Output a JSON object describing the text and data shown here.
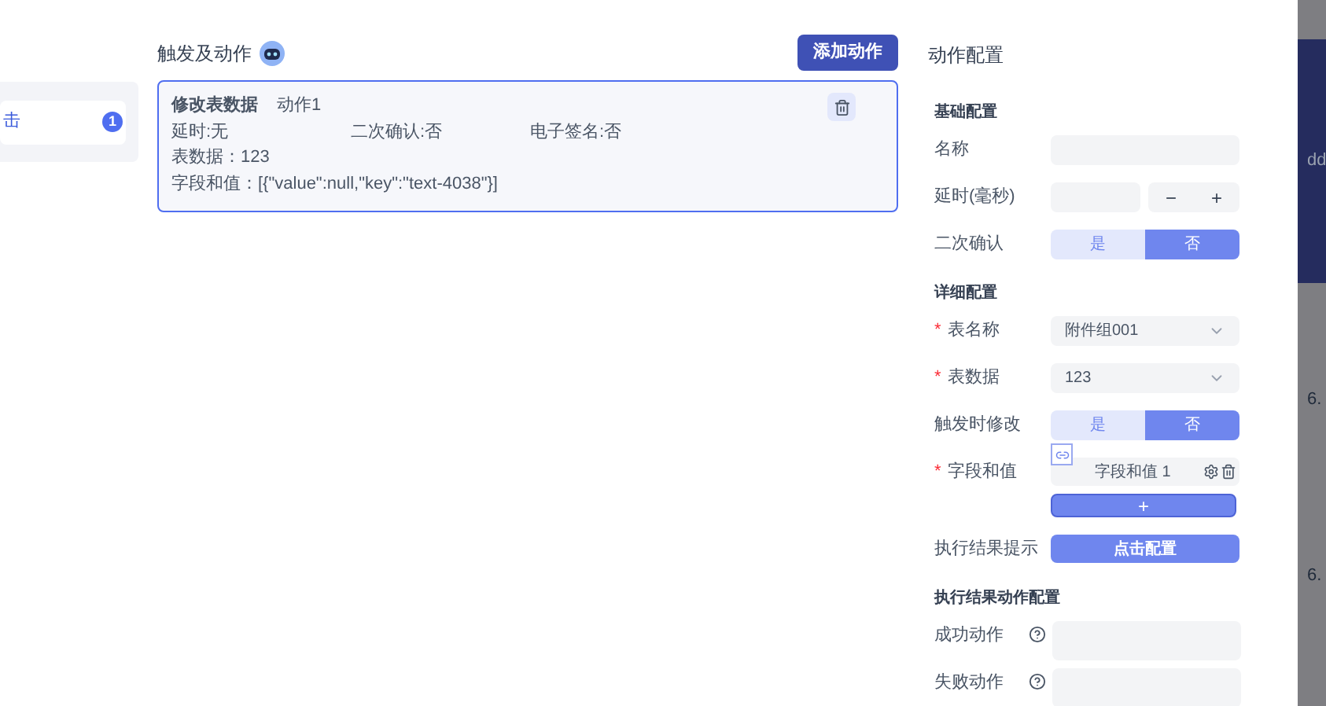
{
  "left_panel": {
    "item": {
      "label": "击",
      "badge": "1",
      "selected": true
    }
  },
  "triggers": {
    "title": "触发及动作",
    "add_button": "添加动作",
    "actions": [
      {
        "type": "修改表数据",
        "name": "动作1",
        "delay": "延时:无",
        "confirm": "二次确认:否",
        "signature": "电子签名:否",
        "table_data": "表数据：123",
        "fields": "字段和值：[{\"value\":null,\"key\":\"text-4038\"}]",
        "selected": true
      }
    ]
  },
  "config": {
    "title": "动作配置",
    "sections": [
      {
        "title": "基础配置",
        "rows": [
          {
            "kind": "input",
            "label": "名称"
          },
          {
            "kind": "stepper",
            "label": "延时(毫秒)",
            "minus": "−",
            "plus": "+"
          },
          {
            "kind": "toggle",
            "label": "二次确认",
            "options": [
              {
                "label": "是",
                "selected": false
              },
              {
                "label": "否",
                "selected": true
              }
            ]
          }
        ]
      },
      {
        "title": "详细配置",
        "rows": [
          {
            "kind": "select",
            "label": "表名称",
            "required": "*",
            "value": "附件组001"
          },
          {
            "kind": "select",
            "label": "表数据",
            "required": "*",
            "value": "123"
          },
          {
            "kind": "toggle",
            "label": "触发时修改",
            "link": true,
            "options": [
              {
                "label": "是",
                "selected": false
              },
              {
                "label": "否",
                "selected": true
              }
            ]
          },
          {
            "kind": "fieldlist",
            "label": "字段和值",
            "required": "*",
            "items": [
              "字段和值 1"
            ],
            "add": "+"
          },
          {
            "kind": "button",
            "label": "执行结果提示",
            "button": "点击配置"
          }
        ]
      },
      {
        "title": "执行结果动作配置",
        "rows": [
          {
            "kind": "help",
            "label": "成功动作"
          },
          {
            "kind": "help",
            "label": "失败动作"
          }
        ]
      }
    ]
  },
  "background": {
    "texts": [
      "dd",
      "6.",
      "6."
    ]
  }
}
